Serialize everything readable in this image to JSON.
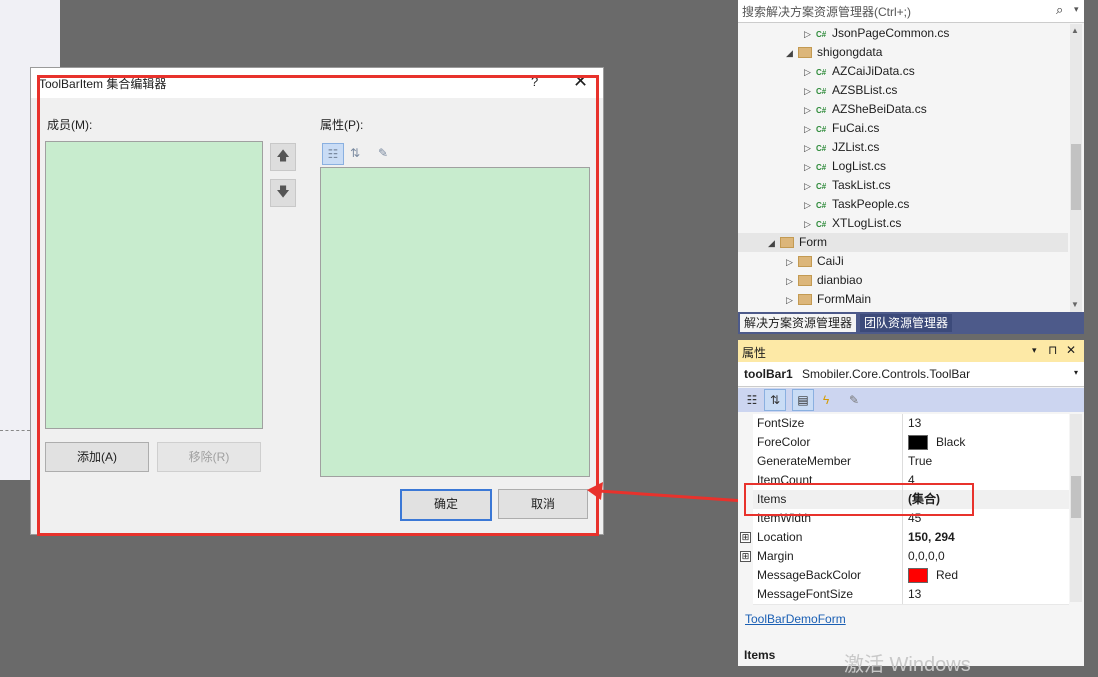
{
  "dialog": {
    "title": "ToolBarItem 集合编辑器",
    "help": "?",
    "close": "✕",
    "members_label": "成员(M):",
    "properties_label": "属性(P):",
    "move_up": "🡅",
    "move_down": "🡇",
    "add_button": "添加(A)",
    "remove_button": "移除(R)",
    "ok_button": "确定",
    "cancel_button": "取消"
  },
  "solution_explorer": {
    "search_placeholder": "搜索解决方案资源管理器(Ctrl+;)",
    "items": [
      {
        "label": "JsonPageCommon.cs",
        "type": "cs",
        "expand": "▷"
      },
      {
        "label": "shigongdata",
        "type": "folder",
        "expand": "◢"
      },
      {
        "label": "AZCaiJiData.cs",
        "type": "cs",
        "expand": "▷"
      },
      {
        "label": "AZSBList.cs",
        "type": "cs",
        "expand": "▷"
      },
      {
        "label": "AZSheBeiData.cs",
        "type": "cs",
        "expand": "▷"
      },
      {
        "label": "FuCai.cs",
        "type": "cs",
        "expand": "▷"
      },
      {
        "label": "JZList.cs",
        "type": "cs",
        "expand": "▷"
      },
      {
        "label": "LogList.cs",
        "type": "cs",
        "expand": "▷"
      },
      {
        "label": "TaskList.cs",
        "type": "cs",
        "expand": "▷"
      },
      {
        "label": "TaskPeople.cs",
        "type": "cs",
        "expand": "▷"
      },
      {
        "label": "XTLogList.cs",
        "type": "cs",
        "expand": "▷"
      },
      {
        "label": "Form",
        "type": "folder",
        "expand": "◢"
      },
      {
        "label": "CaiJi",
        "type": "folder",
        "expand": "▷"
      },
      {
        "label": "dianbiao",
        "type": "folder",
        "expand": "▷"
      },
      {
        "label": "FormMain",
        "type": "folder",
        "expand": "▷"
      }
    ],
    "tabs": [
      "解决方案资源管理器",
      "团队资源管理器"
    ]
  },
  "properties": {
    "title": "属性",
    "pin": "⊓",
    "close": "✕",
    "object_name": "toolBar1",
    "object_type": "Smobiler.Core.Controls.ToolBar",
    "rows": [
      {
        "name": "FontSize",
        "value": "13"
      },
      {
        "name": "ForeColor",
        "value": "Black",
        "swatch": "#000000"
      },
      {
        "name": "GenerateMember",
        "value": "True"
      },
      {
        "name": "ItemCount",
        "value": "4"
      },
      {
        "name": "Items",
        "value": "(集合)"
      },
      {
        "name": "ItemWidth",
        "value": "45"
      },
      {
        "name": "Location",
        "value": "150, 294",
        "expand": "⊞"
      },
      {
        "name": "Margin",
        "value": "0,0,0,0",
        "expand": "⊞"
      },
      {
        "name": "MessageBackColor",
        "value": "Red",
        "swatch": "#ff0000"
      },
      {
        "name": "MessageFontSize",
        "value": "13"
      }
    ],
    "link": "ToolBarDemoForm",
    "desc_title": "Items",
    "watermark": "激活 Windows"
  },
  "colors": {
    "accent_red": "#e8322c",
    "list_bg": "#c8ecce",
    "link": "#1a5fb4"
  }
}
